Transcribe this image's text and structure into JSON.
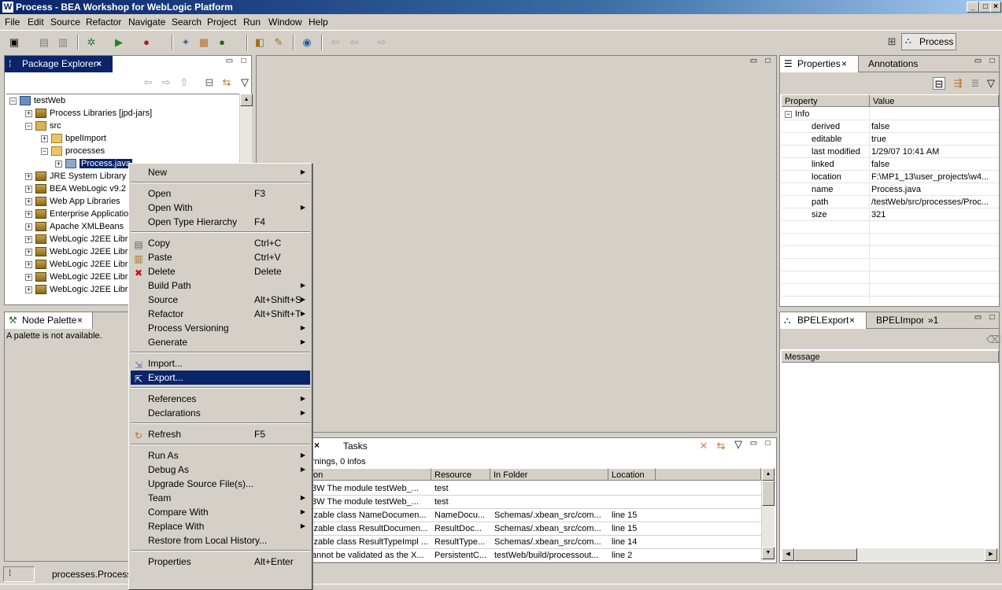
{
  "window": {
    "title": "Process - BEA Workshop for WebLogic Platform",
    "app_icon": "W"
  },
  "menubar": [
    "File",
    "Edit",
    "Source",
    "Refactor",
    "Navigate",
    "Search",
    "Project",
    "Run",
    "Window",
    "Help"
  ],
  "perspective": {
    "label": "Process"
  },
  "package_explorer": {
    "tab": "Package Explorer",
    "tree": [
      {
        "label": "testWeb",
        "icon": "project-icon"
      },
      {
        "label": "Process Libraries [jpd-jars]",
        "icon": "library-icon"
      },
      {
        "label": "src",
        "icon": "source-folder-icon"
      },
      {
        "label": "bpelImport",
        "icon": "package-icon"
      },
      {
        "label": "processes",
        "icon": "package-icon"
      },
      {
        "label": "Process.java",
        "icon": "java-file-icon"
      },
      {
        "label": "JRE System Library",
        "icon": "library-icon"
      },
      {
        "label": "BEA WebLogic v9.2",
        "icon": "library-icon"
      },
      {
        "label": "Web App Libraries",
        "icon": "library-icon"
      },
      {
        "label": "Enterprise Applicatio",
        "icon": "library-icon"
      },
      {
        "label": "Apache XMLBeans",
        "icon": "library-icon"
      },
      {
        "label": "WebLogic J2EE Libr",
        "icon": "library-icon"
      },
      {
        "label": "WebLogic J2EE Libr",
        "icon": "library-icon"
      },
      {
        "label": "WebLogic J2EE Libr",
        "icon": "library-icon"
      },
      {
        "label": "WebLogic J2EE Libr",
        "icon": "library-icon"
      },
      {
        "label": "WebLogic J2EE Libr",
        "icon": "library-icon"
      }
    ]
  },
  "node_palette": {
    "tab": "Node Palette",
    "message": "A palette is not available."
  },
  "properties": {
    "tab": "Properties",
    "tab2": "Annotations",
    "col_property": "Property",
    "col_value": "Value",
    "group": "Info",
    "rows": [
      {
        "name": "derived",
        "value": "false"
      },
      {
        "name": "editable",
        "value": "true"
      },
      {
        "name": "last modified",
        "value": "1/29/07 10:41 AM"
      },
      {
        "name": "linked",
        "value": "false"
      },
      {
        "name": "location",
        "value": "F:\\MP1_13\\user_projects\\w4..."
      },
      {
        "name": "name",
        "value": "Process.java"
      },
      {
        "name": "path",
        "value": "/testWeb/src/processes/Proc..."
      },
      {
        "name": "size",
        "value": "321"
      }
    ]
  },
  "bpel": {
    "tab1": "BPELExport",
    "tab2": "BPELImport",
    "overflow": "»1",
    "col_message": "Message"
  },
  "problems": {
    "tab2": "Tasks",
    "summary": "rnings, 0 infos",
    "headers": [
      "on",
      "Resource",
      "In Folder",
      "Location"
    ],
    "rows": [
      [
        "3W The module testWeb_...",
        "test",
        "",
        ""
      ],
      [
        "3W The module testWeb_...",
        "test",
        "",
        ""
      ],
      [
        "izable class NameDocumen...",
        "NameDocu...",
        "Schemas/.xbean_src/com...",
        "line 15"
      ],
      [
        "izable class ResultDocumen...",
        "ResultDoc...",
        "Schemas/.xbean_src/com...",
        "line 15"
      ],
      [
        "izable class ResultTypeImpl ...",
        "ResultType...",
        "Schemas/.xbean_src/com...",
        "line 14"
      ],
      [
        "annot be validated as the X...",
        "PersistentC...",
        "testWeb/build/processout...",
        "line 2"
      ]
    ]
  },
  "context_menu": {
    "items": [
      {
        "label": "New",
        "sub": true
      },
      {
        "sep": true
      },
      {
        "label": "Open",
        "acc": "F3"
      },
      {
        "label": "Open With",
        "sub": true
      },
      {
        "label": "Open Type Hierarchy",
        "acc": "F4"
      },
      {
        "sep": true
      },
      {
        "label": "Copy",
        "acc": "Ctrl+C",
        "icon": "copy-icon"
      },
      {
        "label": "Paste",
        "acc": "Ctrl+V",
        "icon": "paste-icon"
      },
      {
        "label": "Delete",
        "acc": "Delete",
        "icon": "delete-icon"
      },
      {
        "label": "Build Path",
        "sub": true
      },
      {
        "label": "Source",
        "acc": "Alt+Shift+S",
        "sub": true
      },
      {
        "label": "Refactor",
        "acc": "Alt+Shift+T",
        "sub": true
      },
      {
        "label": "Process Versioning",
        "sub": true
      },
      {
        "label": "Generate",
        "sub": true
      },
      {
        "sep": true
      },
      {
        "label": "Import...",
        "icon": "import-icon"
      },
      {
        "label": "Export...",
        "icon": "export-icon",
        "highlight": true
      },
      {
        "sep": true
      },
      {
        "label": "References",
        "sub": true
      },
      {
        "label": "Declarations",
        "sub": true
      },
      {
        "sep": true
      },
      {
        "label": "Refresh",
        "acc": "F5",
        "icon": "refresh-icon"
      },
      {
        "sep": true
      },
      {
        "label": "Run As",
        "sub": true
      },
      {
        "label": "Debug As",
        "sub": true
      },
      {
        "label": "Upgrade Source File(s)..."
      },
      {
        "label": "Team",
        "sub": true
      },
      {
        "label": "Compare With",
        "sub": true
      },
      {
        "label": "Replace With",
        "sub": true
      },
      {
        "label": "Restore from Local History..."
      },
      {
        "sep": true
      },
      {
        "label": "Properties",
        "acc": "Alt+Enter"
      }
    ]
  },
  "status": {
    "text": "processes.Process.j"
  },
  "colors": {
    "selection": "#0a246a",
    "chrome": "#d4d0c8"
  }
}
